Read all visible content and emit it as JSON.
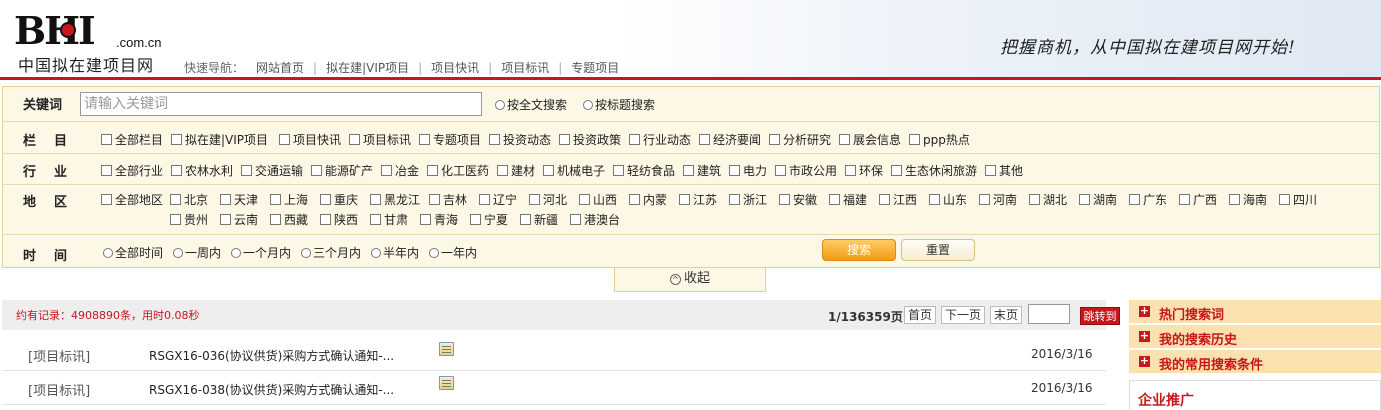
{
  "header": {
    "logo_text": "BHI",
    "logo_domain": ".com.cn",
    "site_name": "中国拟在建项目网",
    "quicknav_label": "快速导航：",
    "quicknav_items": [
      "网站首页",
      "拟在建|VIP项目",
      "项目快讯",
      "项目标讯",
      "专题项目"
    ],
    "slogan": "把握商机，从中国拟在建项目网开始!"
  },
  "search": {
    "keyword_label": "关键词",
    "keyword_placeholder": "请输入关键词",
    "mode_options": [
      "按全文搜索",
      "按标题搜索"
    ],
    "column_label": "栏目",
    "columns": [
      "全部栏目",
      "拟在建|VIP项目",
      "项目快讯",
      "项目标讯",
      "专题项目",
      "投资动态",
      "投资政策",
      "行业动态",
      "经济要闻",
      "分析研究",
      "展会信息",
      "ppp热点"
    ],
    "industry_label": "行业",
    "industries": [
      "全部行业",
      "农林水利",
      "交通运输",
      "能源矿产",
      "冶金",
      "化工医药",
      "建材",
      "机械电子",
      "轻纺食品",
      "建筑",
      "电力",
      "市政公用",
      "环保",
      "生态休闲旅游",
      "其他"
    ],
    "region_label": "地区",
    "regions_row1": [
      "全部地区",
      "北京",
      "天津",
      "上海",
      "重庆",
      "黑龙江",
      "吉林",
      "辽宁",
      "河北",
      "山西",
      "内蒙",
      "江苏",
      "浙江",
      "安徽",
      "福建",
      "江西",
      "山东",
      "河南",
      "湖北",
      "湖南",
      "广东",
      "广西",
      "海南",
      "四川"
    ],
    "regions_row2": [
      "贵州",
      "云南",
      "西藏",
      "陕西",
      "甘肃",
      "青海",
      "宁夏",
      "新疆",
      "港澳台"
    ],
    "time_label": "时间",
    "times": [
      "全部时间",
      "一周内",
      "一个月内",
      "三个月内",
      "半年内",
      "一年内"
    ],
    "search_button": "搜索",
    "reset_button": "重置",
    "collapse_label": "收起"
  },
  "results": {
    "summary": "约有记录：4908890条，用时0.08秒",
    "page_info": "1/136359页",
    "first_page": "首页",
    "next_page": "下一页",
    "last_page": "末页",
    "goto_button": "跳转到",
    "items": [
      {
        "category": "[项目标讯]",
        "title": "RSGX16-036(协议供货)采购方式确认通知-...",
        "date": "2016/3/16"
      },
      {
        "category": "[项目标讯]",
        "title": "RSGX16-038(协议供货)采购方式确认通知-...",
        "date": "2016/3/16"
      }
    ]
  },
  "sidebar": {
    "items": [
      "热门搜索词",
      "我的搜索历史",
      "我的常用搜索条件"
    ],
    "promo_title": "企业推广"
  },
  "colors": {
    "brand_red": "#c8161d",
    "panel_bg": "#fdf7e6",
    "search_orange": "#f29b17"
  }
}
